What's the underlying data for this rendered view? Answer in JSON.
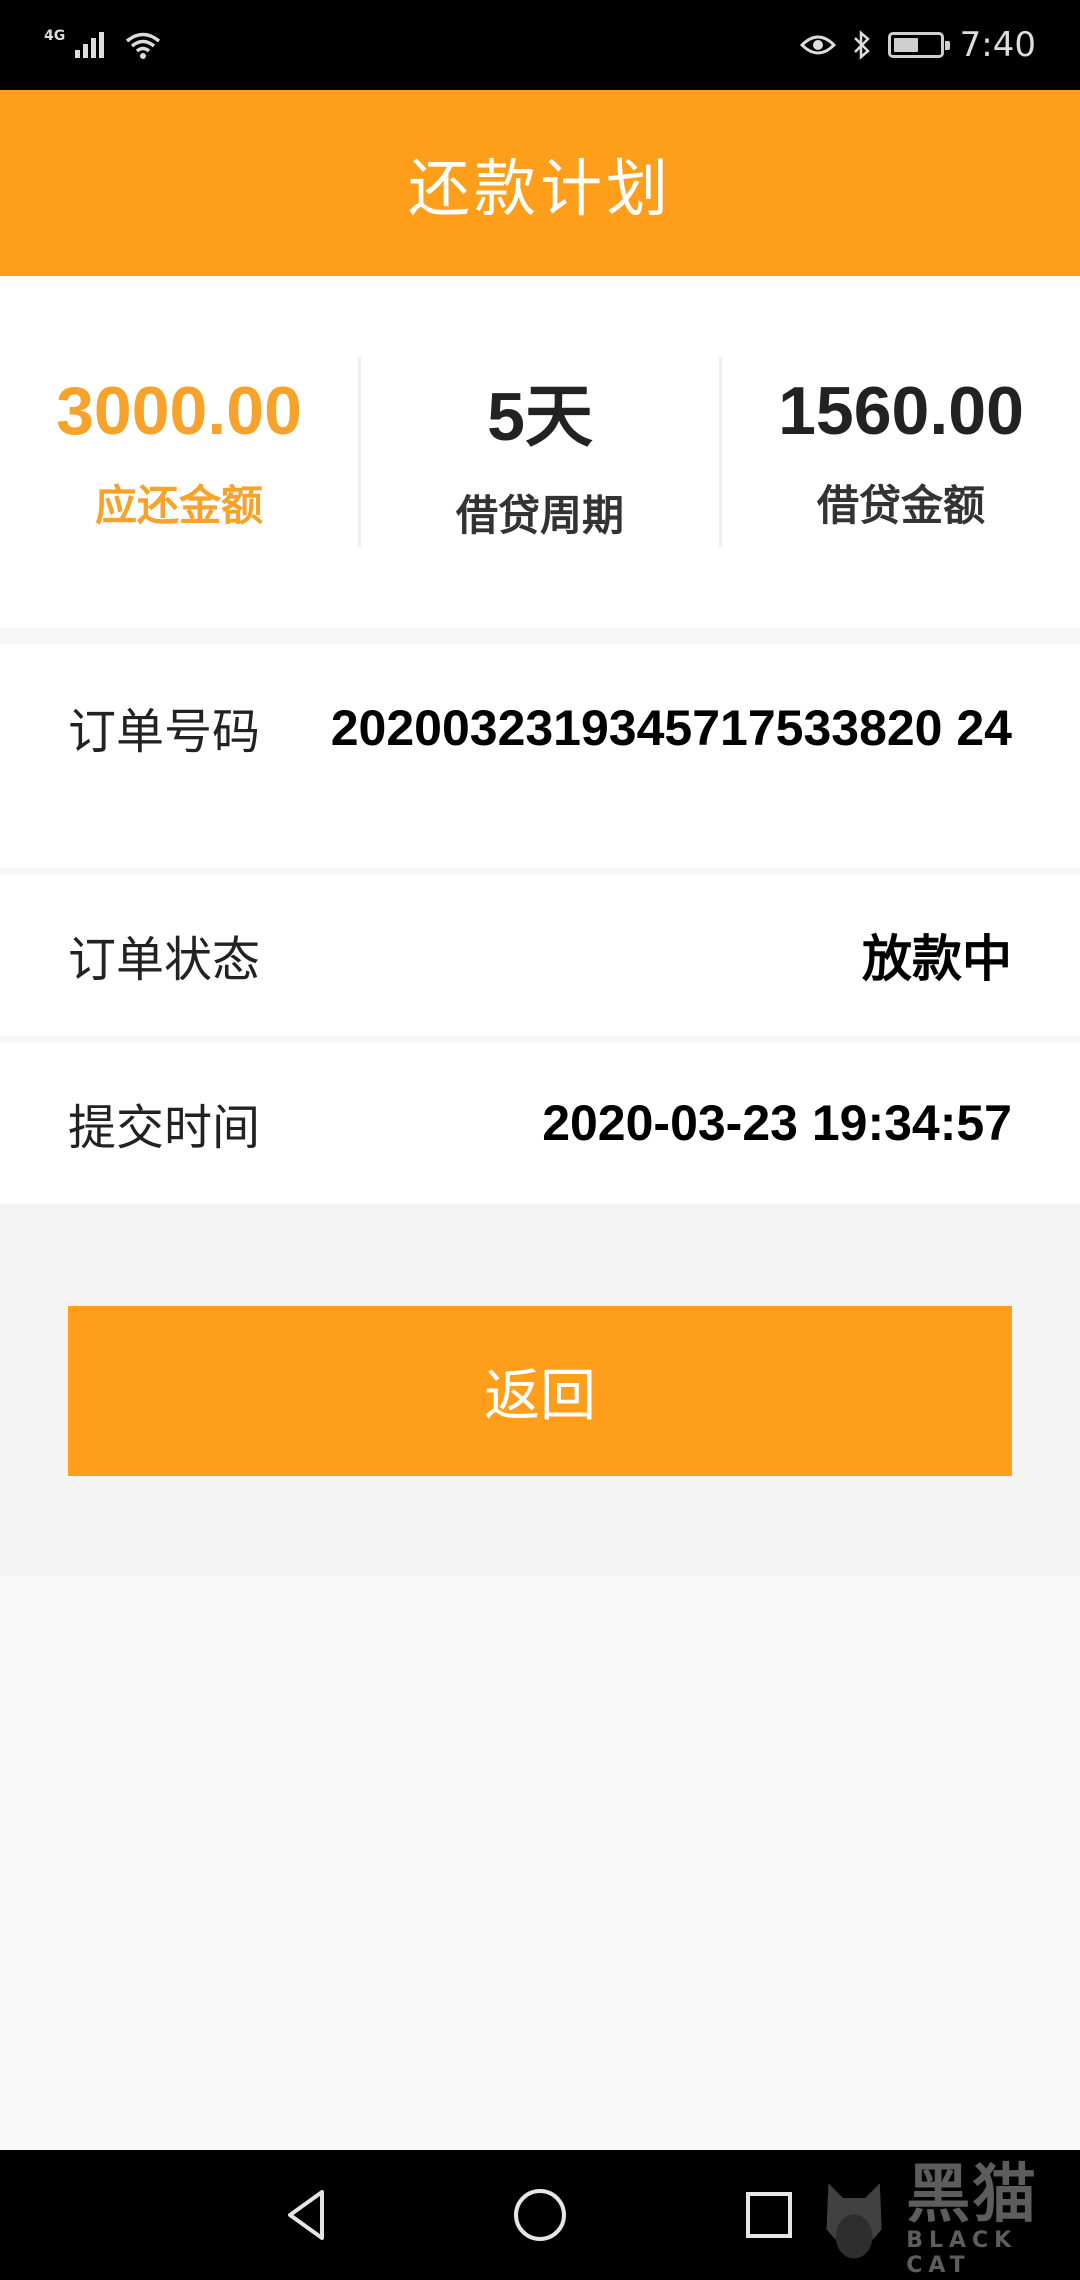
{
  "status_bar": {
    "network": "4G",
    "time": "7:40"
  },
  "header": {
    "title": "还款计划"
  },
  "summary": [
    {
      "value": "3000.00",
      "label": "应还金额",
      "highlight": true
    },
    {
      "value": "5天",
      "label": "借贷周期",
      "highlight": false
    },
    {
      "value": "1560.00",
      "label": "借贷金额",
      "highlight": false
    }
  ],
  "details": {
    "order_number": {
      "label": "订单号码",
      "value": "2020032319345717533820 24"
    },
    "order_status": {
      "label": "订单状态",
      "value": "放款中"
    },
    "submit_time": {
      "label": "提交时间",
      "value": "2020-03-23 19:34:57"
    }
  },
  "actions": {
    "back_label": "返回"
  },
  "watermark": {
    "cn": "黑猫",
    "en": "BLACK CAT"
  },
  "colors": {
    "accent": "#ff9e1b",
    "highlight_text": "#f7a22a"
  }
}
